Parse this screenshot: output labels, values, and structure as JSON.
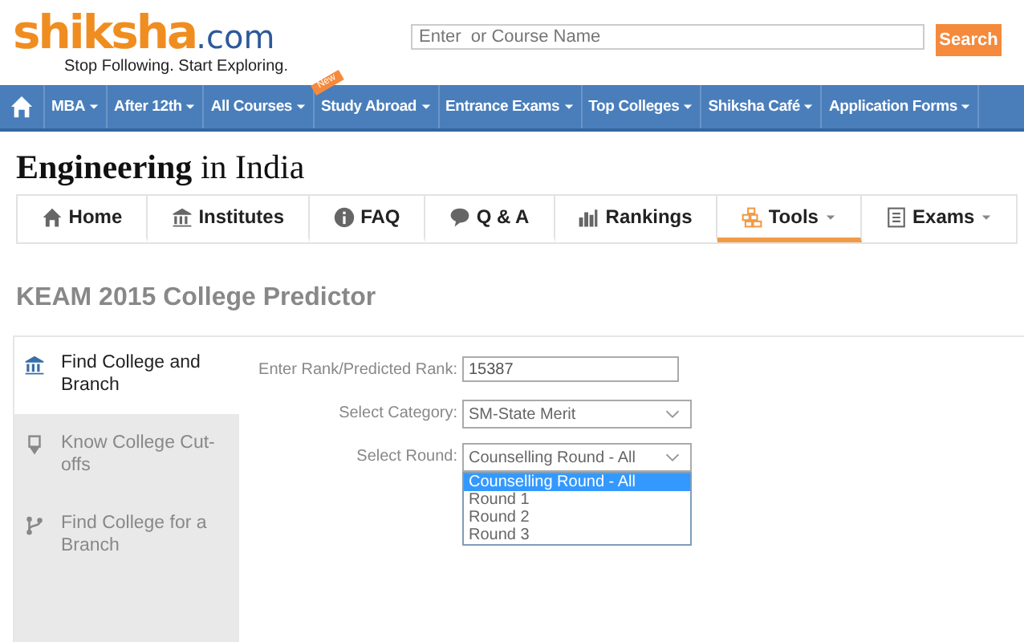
{
  "header": {
    "logo": {
      "brand": "shiksha",
      "domain": ".com",
      "tagline": "Stop Following. Start Exploring."
    },
    "search": {
      "placeholder": "Enter  or Course Name",
      "button": "Search"
    }
  },
  "nav": {
    "items": [
      {
        "label": "MBA",
        "dropdown": true
      },
      {
        "label": "After 12th",
        "dropdown": true
      },
      {
        "label": "All Courses",
        "dropdown": true
      },
      {
        "label": "Study Abroad",
        "dropdown": true,
        "badge": "New"
      },
      {
        "label": "Entrance Exams",
        "dropdown": true
      },
      {
        "label": "Top Colleges",
        "dropdown": true
      },
      {
        "label": "Shiksha Café",
        "dropdown": true
      },
      {
        "label": "Application Forms",
        "dropdown": true
      }
    ]
  },
  "page_title": "**Engineering** in India",
  "tabs": [
    {
      "label": "Home",
      "dropdown": false,
      "selected": false
    },
    {
      "label": "Institutes",
      "dropdown": false,
      "selected": false
    },
    {
      "label": "FAQ",
      "dropdown": false,
      "selected": false
    },
    {
      "label": "Q & A",
      "dropdown": false,
      "selected": false
    },
    {
      "label": "Rankings",
      "dropdown": false,
      "selected": false
    },
    {
      "label": "Tools",
      "dropdown": true,
      "selected": true
    },
    {
      "label": "Exams",
      "dropdown": true,
      "selected": false
    }
  ],
  "heading": "KEAM 2015 College Predictor",
  "sidebar": {
    "items": [
      {
        "label": "Find College and Branch",
        "selected": true
      },
      {
        "label": "Know College Cut-offs",
        "selected": false
      },
      {
        "label": "Find College for a Branch",
        "selected": false
      }
    ]
  },
  "form": {
    "fields": [
      {
        "label": "Enter Rank/Predicted Rank:",
        "kind": "text",
        "value": "15387"
      },
      {
        "label": "Select Category:",
        "kind": "select",
        "value": "SM-State Merit"
      },
      {
        "label": "Select Round:",
        "kind": "select",
        "value": "Counselling Round - All",
        "open": true,
        "options": [
          {
            "label": "Counselling Round - All",
            "selected": true
          },
          {
            "label": "Round 1",
            "selected": false
          },
          {
            "label": "Round 2",
            "selected": false
          },
          {
            "label": "Round 3",
            "selected": false
          }
        ]
      }
    ]
  }
}
